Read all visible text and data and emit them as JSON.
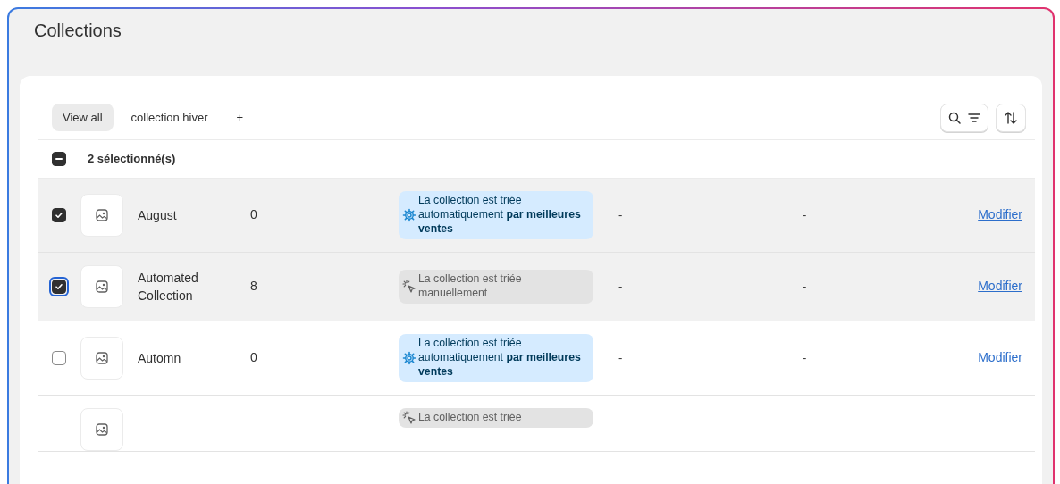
{
  "page": {
    "title": "Collections"
  },
  "tabs": [
    {
      "label": "View all",
      "selected": true
    },
    {
      "label": "collection hiver",
      "selected": false
    },
    {
      "label": "+",
      "selected": false
    }
  ],
  "bulk": {
    "label": "2 sélectionné(s)",
    "indeterminate": true
  },
  "rows": [
    {
      "checked": true,
      "focused": false,
      "name": "August",
      "count": "0",
      "sort": {
        "kind": "auto",
        "text": "La collection est triée automatiquement **par meilleures ventes**"
      },
      "column_5": "-",
      "column_6": "-",
      "action": "Modifier"
    },
    {
      "checked": true,
      "focused": true,
      "name": "Automated Collection",
      "count": "8",
      "sort": {
        "kind": "manual",
        "text": "La collection est triée manuellement"
      },
      "column_5": "-",
      "column_6": "-",
      "action": "Modifier"
    },
    {
      "checked": false,
      "focused": false,
      "name": "Automn",
      "count": "0",
      "sort": {
        "kind": "auto",
        "text": "La collection est triée automatiquement **par meilleures ventes**"
      },
      "column_5": "-",
      "column_6": "-",
      "action": "Modifier"
    },
    {
      "sort": {
        "kind": "manual",
        "text": "La collection est triée"
      }
    }
  ]
}
